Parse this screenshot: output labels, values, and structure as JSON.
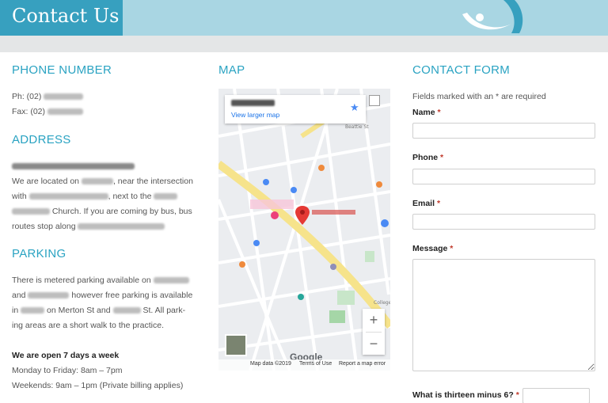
{
  "header": {
    "title": "Contact Us",
    "accent_color": "#37a0bf",
    "banner_color": "#a9d6e3"
  },
  "left": {
    "phone_heading": "PHONE NUMBER",
    "phone_label": "Ph: (02)",
    "fax_label": "Fax: (02)",
    "address_heading": "ADDRESS",
    "address_line1": "We are located on",
    "address_line1b": ", near the intersection",
    "address_line2": "with",
    "address_line2b": ", next to the",
    "address_line3b": "Church. If you are coming by bus, bus",
    "address_line4": "routes stop along",
    "parking_heading": "PARKING",
    "parking_line1": "There is metered parking available on",
    "parking_line2": "and",
    "parking_line2b": "however free parking is available",
    "parking_line3": "in",
    "parking_line3b": "on Merton St and",
    "parking_line3c": "St. All park-",
    "parking_line4": "ing areas are a short walk to the practice.",
    "hours_title": "We are open 7 days a week",
    "hours_weekday": "Monday to Friday: 8am – 7pm",
    "hours_weekend": "Weekends: 9am – 1pm (Private billing applies)"
  },
  "map": {
    "heading": "MAP",
    "view_larger": "View larger map",
    "zoom_in": "+",
    "zoom_out": "−",
    "google": "Google",
    "map_data": "Map data ©2019",
    "terms": "Terms of Use",
    "report": "Report a map error",
    "street_beattie": "Beattie St",
    "street_bottom": "College",
    "icons": [
      "star-icon",
      "fullscreen-icon",
      "location-pin-icon",
      "satellite-thumbnail"
    ]
  },
  "form": {
    "heading": "CONTACT FORM",
    "required_note_pre": "Fields marked with an",
    "required_note_star": "*",
    "required_note_post": "are required",
    "name_label": "Name",
    "phone_label": "Phone",
    "email_label": "Email",
    "message_label": "Message",
    "captcha_label": "What is thirteen minus 6?",
    "required_star": "*",
    "name_value": "",
    "phone_value": "",
    "email_value": "",
    "message_value": "",
    "captcha_value": ""
  }
}
